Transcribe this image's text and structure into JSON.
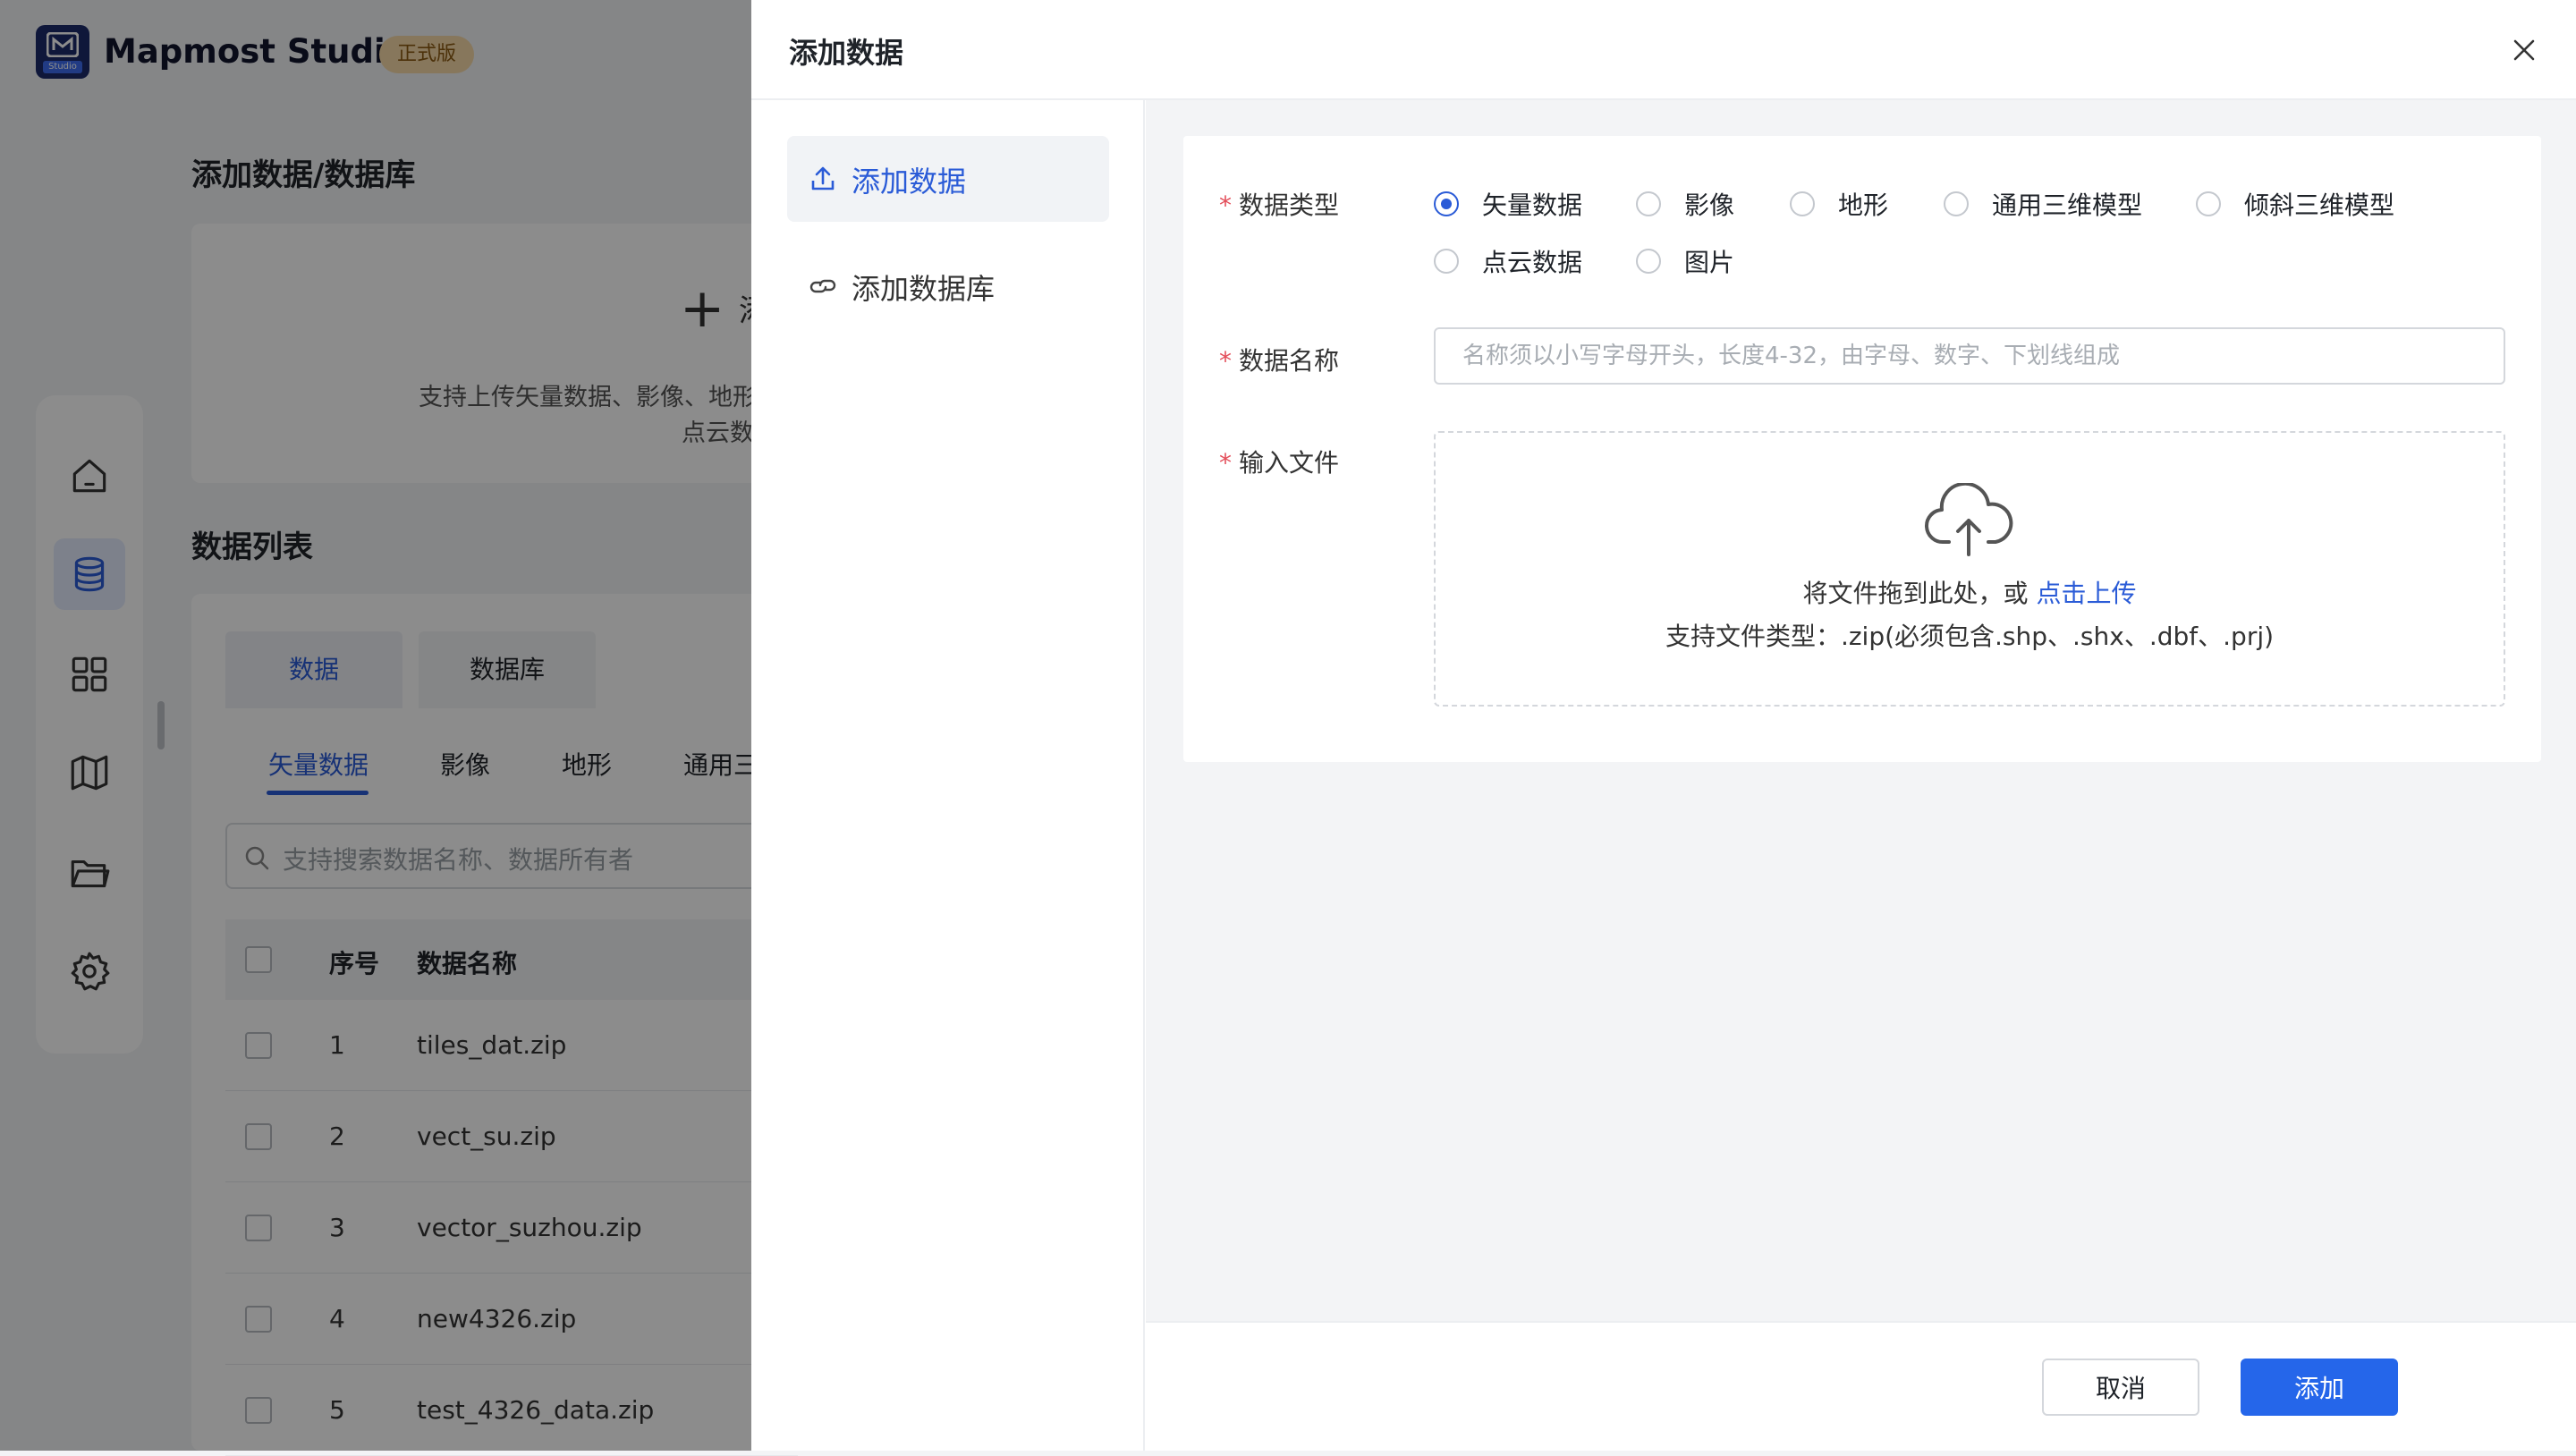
{
  "app": {
    "logo_label": "Studio",
    "name": "Mapmost Studio",
    "edition": "正式版"
  },
  "background": {
    "upload_section_title": "添加数据/数据库",
    "upload_card_plus_text": "添",
    "upload_card_desc_line1": "支持上传矢量数据、影像、地形",
    "upload_card_desc_line2": "点云数",
    "list_title": "数据列表",
    "tabs": [
      "数据",
      "数据库"
    ],
    "subtabs": [
      "矢量数据",
      "影像",
      "地形",
      "通用三"
    ],
    "search_placeholder": "支持搜索数据名称、数据所有者",
    "columns": [
      "序号",
      "数据名称"
    ],
    "rows": [
      {
        "no": "1",
        "name": "tiles_dat.zip"
      },
      {
        "no": "2",
        "name": "vect_su.zip"
      },
      {
        "no": "3",
        "name": "vector_suzhou.zip"
      },
      {
        "no": "4",
        "name": "new4326.zip"
      },
      {
        "no": "5",
        "name": "test_4326_data.zip"
      }
    ],
    "rail_icons": [
      "home-icon",
      "database-icon",
      "apps-grid-icon",
      "map-icon",
      "folder-icon",
      "settings-icon"
    ]
  },
  "drawer": {
    "title": "添加数据",
    "nav": [
      {
        "label": "添加数据",
        "icon": "upload-icon",
        "active": true
      },
      {
        "label": "添加数据库",
        "icon": "link-icon",
        "active": false
      }
    ],
    "form": {
      "required_mark": "*",
      "type_label": "数据类型",
      "type_options": [
        "矢量数据",
        "影像",
        "地形",
        "通用三维模型",
        "倾斜三维模型",
        "点云数据",
        "图片"
      ],
      "type_selected": "矢量数据",
      "name_label": "数据名称",
      "name_value": "",
      "name_placeholder": "名称须以小写字母开头，长度4-32，由字母、数字、下划线组成",
      "file_label": "输入文件",
      "drop_text": "将文件拖到此处，或",
      "drop_link": "点击上传",
      "drop_hint": "支持文件类型：.zip(必须包含.shp、.shx、.dbf、.prj)"
    },
    "cancel_label": "取消",
    "submit_label": "添加"
  },
  "colors": {
    "accent": "#2a5bd7",
    "primary_button": "#2566ea",
    "required": "#e34d59",
    "overlay": "rgba(0,0,0,0.45)"
  }
}
